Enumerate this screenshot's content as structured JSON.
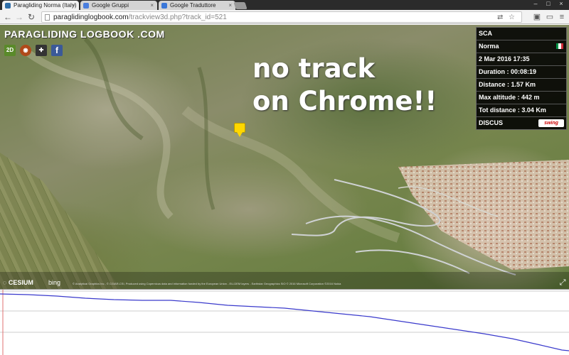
{
  "browser": {
    "tabs": [
      {
        "title": "Paragliding Norma (Italy)",
        "favicon_color": "#2f6ea8",
        "active": true
      },
      {
        "title": "Google Gruppi",
        "favicon_color": "#4a7ede",
        "active": false
      },
      {
        "title": "Google Traduttore",
        "favicon_color": "#3a77d8",
        "active": false
      }
    ],
    "url_host": "paraglidinglogbook.com",
    "url_path": "/trackview3d.php?track_id=521"
  },
  "site": {
    "brand": "PARAGLIDING LOGBOOK .COM",
    "icons": [
      {
        "name": "google-earth-2d-icon",
        "label": "2D",
        "color": "#5a8a2a"
      },
      {
        "name": "pilot-icon",
        "label": "",
        "color": "#b04a1a"
      },
      {
        "name": "gamepad-icon",
        "label": "",
        "color": "#333333"
      },
      {
        "name": "facebook-icon",
        "label": "f",
        "color": "#3b5998"
      }
    ]
  },
  "annotation": {
    "line1": "no track",
    "line2": "on Chrome!!"
  },
  "info": {
    "pilot": "SCA",
    "site": "Norma",
    "flag_colors": [
      "#009246",
      "#ffffff",
      "#ce2b37"
    ],
    "date": "2 Mar 2016 17:35",
    "duration": "Duration : 00:08:19",
    "distance": "Distance : 1.57 Km",
    "max_altitude": "Max altitude : 442 m",
    "tot_distance": "Tot distance : 3.04 Km",
    "glider": "DISCUS",
    "glider_brand": "swing"
  },
  "map": {
    "engine": "CESIUM",
    "imagery": "bing",
    "credits": "© Analytical Graphics Inc., © CGIAR-CSI, Produced using Copernicus data and information funded by the European Union - EU-DEM layers - Earthstar Geographics SIO © 2016 Microsoft Corporation ©2016 Nokia"
  },
  "colors": {
    "panel_bg": "#000000",
    "elevation_line": "#3a3acc"
  }
}
